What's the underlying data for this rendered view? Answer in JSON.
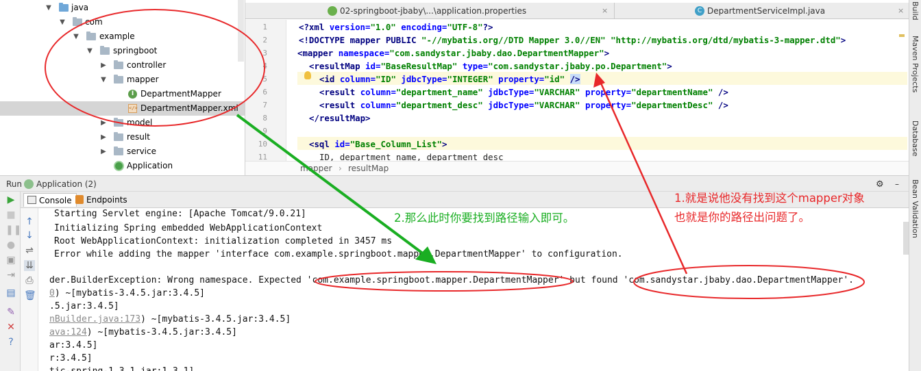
{
  "project_tree": {
    "items": [
      {
        "label": "java",
        "type": "source-folder",
        "expanded": true
      },
      {
        "label": "com",
        "type": "package",
        "expanded": true
      },
      {
        "label": "example",
        "type": "package",
        "expanded": true
      },
      {
        "label": "springboot",
        "type": "package",
        "expanded": true
      },
      {
        "label": "controller",
        "type": "package",
        "expanded": false
      },
      {
        "label": "mapper",
        "type": "package",
        "expanded": true
      },
      {
        "label": "DepartmentMapper",
        "type": "interface"
      },
      {
        "label": "DepartmentMapper.xml",
        "type": "xml",
        "selected": true
      },
      {
        "label": "model",
        "type": "package",
        "expanded": false
      },
      {
        "label": "result",
        "type": "package",
        "expanded": false
      },
      {
        "label": "service",
        "type": "package",
        "expanded": false
      },
      {
        "label": "Application",
        "type": "app-class"
      }
    ]
  },
  "editor": {
    "tabs": [
      {
        "label": "02-springboot-jbaby\\...\\application.properties",
        "icon": "spring-leaf-icon",
        "close": "×"
      },
      {
        "label": "DepartmentServiceImpl.java",
        "icon": "class-c-icon",
        "close": "×"
      }
    ],
    "line_numbers": [
      "1",
      "2",
      "3",
      "4",
      "5",
      "6",
      "7",
      "8",
      "9",
      "10",
      "11"
    ],
    "lines": {
      "l1": {
        "a": "<?xml ",
        "b": "version=",
        "c": "\"1.0\" ",
        "d": "encoding=",
        "e": "\"UTF-8\"",
        "f": "?>"
      },
      "l2": {
        "a": "<!DOCTYPE mapper PUBLIC ",
        "b": "\"-//mybatis.org//DTD Mapper 3.0//EN\" ",
        "c": "\"http://mybatis.org/dtd/mybatis-3-mapper.dtd\"",
        "d": ">"
      },
      "l3": {
        "a": "<mapper ",
        "b": "namespace=",
        "c": "\"com.sandystar.jbaby.dao.DepartmentMapper\"",
        "d": ">"
      },
      "l4": {
        "a": "<resultMap ",
        "b": "id=",
        "c": "\"BaseResultMap\" ",
        "d": "type=",
        "e": "\"com.sandystar.jbaby.po.Department\"",
        "f": ">"
      },
      "l5": {
        "a": "<id ",
        "b": "column=",
        "c": "\"ID\" ",
        "d": "jdbcType=",
        "e": "\"INTEGER\" ",
        "f": "property=",
        "g": "\"id\" ",
        "h": "/>"
      },
      "l6": {
        "a": "<result ",
        "b": "column=",
        "c": "\"department_name\" ",
        "d": "jdbcType=",
        "e": "\"VARCHAR\" ",
        "f": "property=",
        "g": "\"departmentName\" ",
        "h": "/>"
      },
      "l7": {
        "a": "<result ",
        "b": "column=",
        "c": "\"department_desc\" ",
        "d": "jdbcType=",
        "e": "\"VARCHAR\" ",
        "f": "property=",
        "g": "\"departmentDesc\" ",
        "h": "/>"
      },
      "l8": {
        "a": "</resultMap>"
      },
      "l10": {
        "a": "<sql ",
        "b": "id=",
        "c": "\"Base_Column_List\"",
        "d": ">"
      },
      "l11": {
        "a": "ID, department_name, department_desc"
      }
    },
    "breadcrumb": {
      "item1": "mapper",
      "sep": "›",
      "item2": "resultMap"
    }
  },
  "run_panel": {
    "run_label": "Run",
    "config_label": "Application (2)",
    "tabs": [
      {
        "label": "Console"
      },
      {
        "label": "Endpoints"
      }
    ],
    "gear": "⚙",
    "minimize": "–"
  },
  "console_lines": [
    "Starting Servlet engine: [Apache Tomcat/9.0.21]",
    "Initializing Spring embedded WebApplicationContext",
    "Root WebApplicationContext: initialization completed in 3457 ms",
    "Error while adding the mapper 'interface com.example.springboot.mapper.DepartmentMapper' to configuration.",
    "",
    "der.BuilderException: Wrong namespace. Expected 'com.example.springboot.mapper.DepartmentMapper' but found 'com.sandystar.jbaby.dao.DepartmentMapper'.",
    {
      "link": "0",
      "rest": ") ~[mybatis-3.4.5.jar:3.4.5]"
    },
    ".5.jar:3.4.5]",
    {
      "link": "nBuilder.java:173",
      "rest": ") ~[mybatis-3.4.5.jar:3.4.5]"
    },
    {
      "link": "ava:124",
      "rest": ") ~[mybatis-3.4.5.jar:3.4.5]"
    },
    "ar:3.4.5]",
    "r:3.4.5]",
    "tic-spring-1.3.1.jar:1.3.1]"
  ],
  "right_strip": [
    "Build",
    "Maven Projects",
    "Database",
    "Bean Validation"
  ],
  "annotations": {
    "red_line1": "1.就是说他没有找到这个mapper对象",
    "red_line2": "也就是你的路径出问题了。",
    "green": "2.那么此时你要找到路径输入即可。",
    "red_color": "#e8282a",
    "green_color": "#1aae22"
  }
}
